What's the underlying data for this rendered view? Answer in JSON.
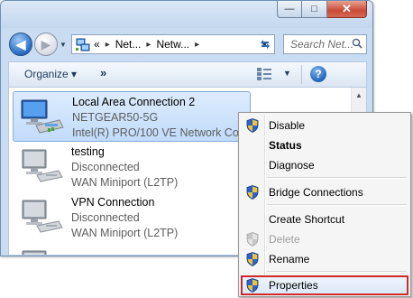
{
  "window": {
    "minimize_glyph": "—",
    "maximize_glyph": "□",
    "close_glyph": "✕"
  },
  "nav": {
    "back_glyph": "◀",
    "forward_glyph": "▶",
    "address_overflow": "«",
    "breadcrumb": [
      "Net...",
      "Netw..."
    ],
    "breadcrumb_separator": "▸",
    "search_placeholder": "Search Net..."
  },
  "toolbar": {
    "organize_label": "Organize ▾",
    "more_label": "»",
    "help_label": "?"
  },
  "connections": [
    {
      "name": "Local Area Connection 2",
      "status": "NETGEAR50-5G",
      "device": "Intel(R) PRO/100 VE Network Con...",
      "selected": true
    },
    {
      "name": "testing",
      "status": "Disconnected",
      "device": "WAN Miniport (L2TP)",
      "selected": false
    },
    {
      "name": "VPN Connection",
      "status": "Disconnected",
      "device": "WAN Miniport (L2TP)",
      "selected": false
    }
  ],
  "context_menu": {
    "items": [
      {
        "label": "Disable",
        "shield": true,
        "bold": false,
        "disabled": false
      },
      {
        "label": "Status",
        "shield": false,
        "bold": true,
        "disabled": false
      },
      {
        "label": "Diagnose",
        "shield": false,
        "bold": false,
        "disabled": false
      },
      {
        "label": "Bridge Connections",
        "shield": true,
        "bold": false,
        "disabled": false
      },
      {
        "label": "Create Shortcut",
        "shield": false,
        "bold": false,
        "disabled": false
      },
      {
        "label": "Delete",
        "shield": true,
        "bold": false,
        "disabled": true
      },
      {
        "label": "Rename",
        "shield": true,
        "bold": false,
        "disabled": false
      },
      {
        "label": "Properties",
        "shield": true,
        "bold": false,
        "disabled": false,
        "highlighted": true
      }
    ]
  },
  "colors": {
    "highlight_box": "#d12a2a",
    "selection_bg": "#c1dcfb",
    "window_frame": "#c9dcf1"
  }
}
